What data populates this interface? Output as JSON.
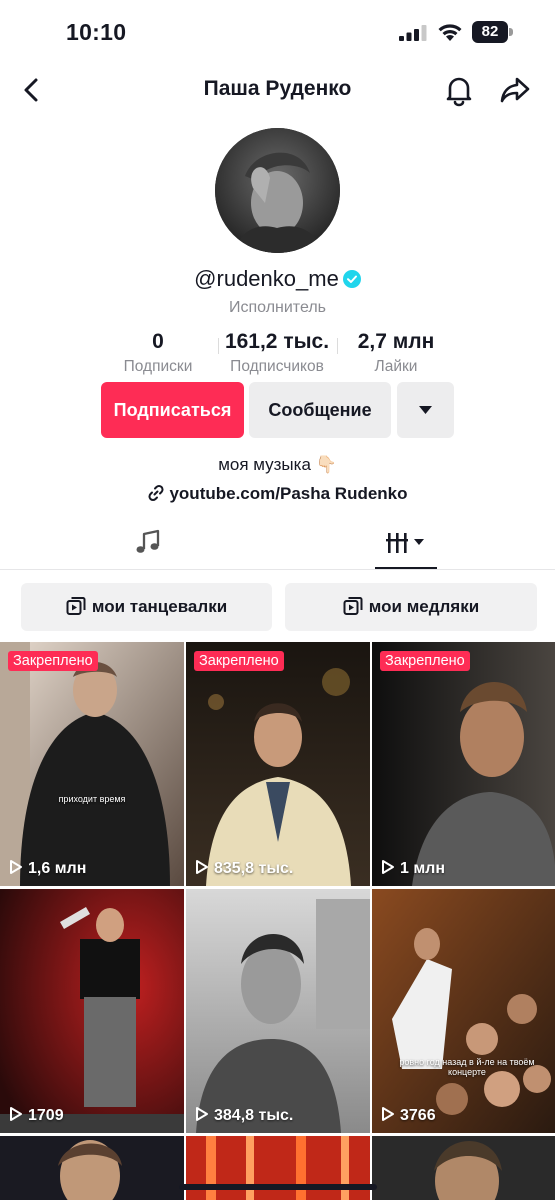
{
  "status_bar": {
    "time": "10:10",
    "battery": "82"
  },
  "nav": {
    "title": "Паша Руденко"
  },
  "profile": {
    "username": "@rudenko_me",
    "category": "Исполнитель",
    "stats": [
      {
        "value": "0",
        "label": "Подписки"
      },
      {
        "value": "161,2 тыс.",
        "label": "Подписчиков"
      },
      {
        "value": "2,7 млн",
        "label": "Лайки"
      }
    ],
    "follow_label": "Подписаться",
    "message_label": "Сообщение",
    "bio": "моя музыка 👇🏻",
    "link": "youtube.com/Pasha Rudenko"
  },
  "playlists": [
    "мои танцевалки",
    "мои медляки"
  ],
  "videos": [
    {
      "pinned": "Закреплено",
      "views": "1,6 млн",
      "caption": "приходит время"
    },
    {
      "pinned": "Закреплено",
      "views": "835,8 тыс.",
      "caption": ""
    },
    {
      "pinned": "Закреплено",
      "views": "1 млн",
      "caption": ""
    },
    {
      "pinned": "",
      "views": "1709",
      "caption": ""
    },
    {
      "pinned": "",
      "views": "384,8 тыс.",
      "caption": ""
    },
    {
      "pinned": "",
      "views": "3766",
      "caption": "ровно год назад в й-ле на твоём концерте"
    }
  ],
  "colors": {
    "accent": "#fe2c55",
    "verified": "#20d5ec",
    "text": "#161823",
    "muted": "#8a8b91"
  }
}
